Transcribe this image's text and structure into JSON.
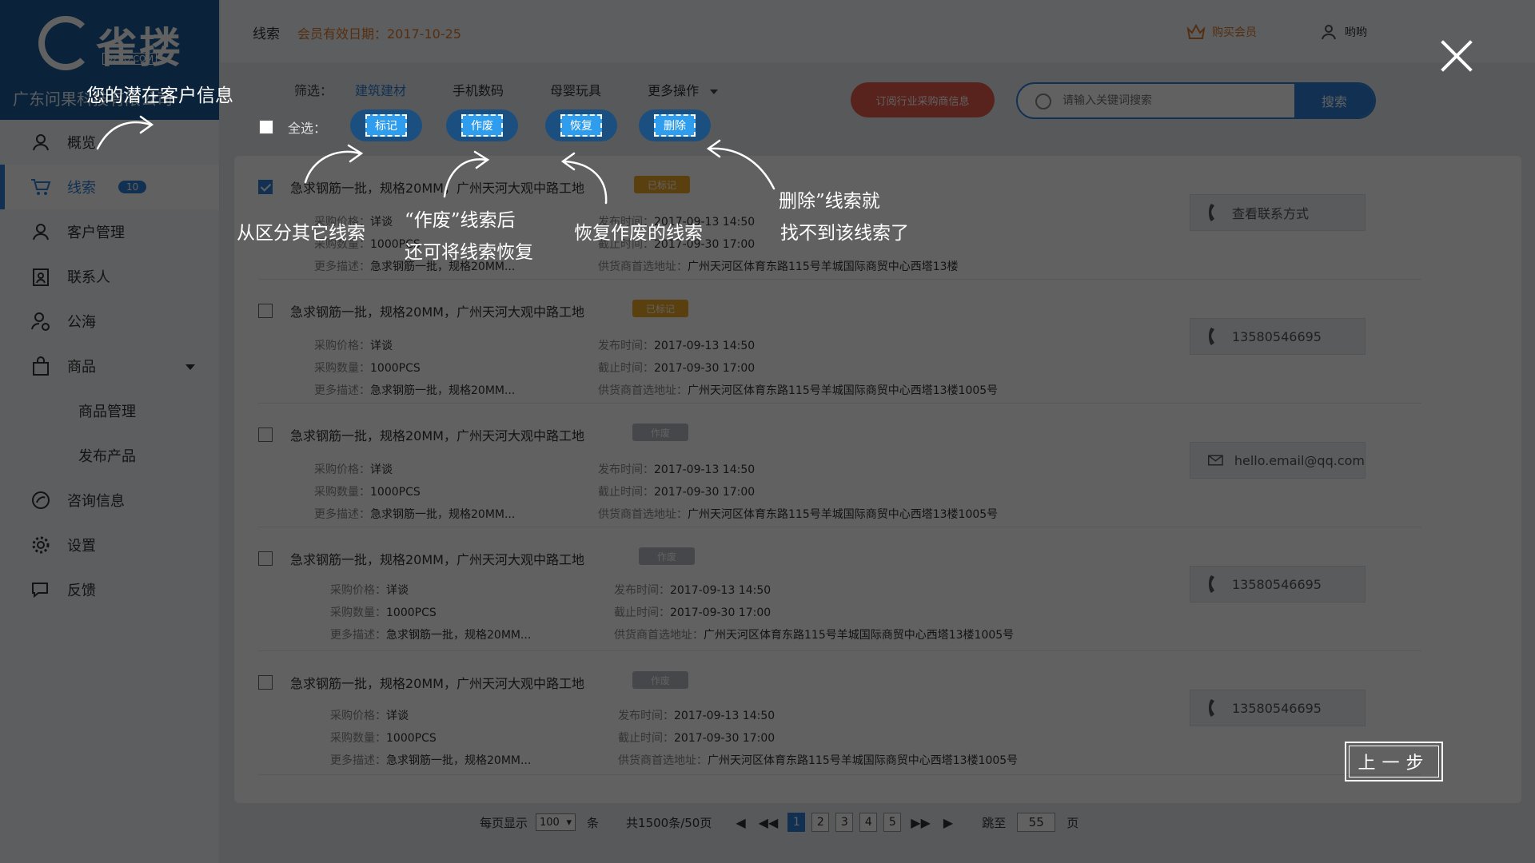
{
  "brand": {
    "logo_text": "雀搂",
    "logo_sub": "Q2SO.COM",
    "company": "广东问果科技有限公司"
  },
  "sidebar": {
    "items": [
      {
        "label": "概览"
      },
      {
        "label": "线索",
        "badge": "10"
      },
      {
        "label": "客户管理"
      },
      {
        "label": "联系人"
      },
      {
        "label": "公海"
      },
      {
        "label": "商品"
      },
      {
        "label": "商品管理"
      },
      {
        "label": "发布产品"
      },
      {
        "label": "咨询信息"
      },
      {
        "label": "设置"
      },
      {
        "label": "反馈"
      }
    ]
  },
  "header": {
    "breadcrumb": "线索",
    "membership": "会员有效日期：2017-10-25",
    "buy_label": "购买会员",
    "user_name": "哟哟"
  },
  "filter": {
    "label": "筛选：",
    "options": [
      "建筑建材",
      "手机数码",
      "母婴玩具",
      "更多操作"
    ],
    "selected": "建筑建材"
  },
  "subscribe_label": "订阅行业采购商信息",
  "search": {
    "placeholder": "请输入关键词搜索",
    "button": "搜索"
  },
  "select_all_label": "全选：",
  "actions": {
    "mark": "标记",
    "void": "作废",
    "restore": "恢复",
    "delete": "删除"
  },
  "leads": [
    {
      "title": "急求钢筋一批，规格20MM，广州天河大观中路工地",
      "tag": "已标记",
      "price_label": "采购价格：",
      "price": "详谈",
      "qty_label": "采购数量：",
      "qty": "1000PCS",
      "desc_label": "更多描述：",
      "desc": "急求钢筋一批，规格20MM...",
      "pub_label": "发布时间：",
      "pub": "2017-09-13 14:50",
      "end_label": "截止时间：",
      "end": "2017-09-30 17:00",
      "addr_label": "供货商首选地址：",
      "addr": "广州天河区体育东路115号羊城国际商贸中心西塔13楼",
      "contact": "查看联系方式",
      "checked": true
    },
    {
      "title": "急求钢筋一批，规格20MM，广州天河大观中路工地",
      "tag": "已标记",
      "price_label": "采购价格：",
      "price": "详谈",
      "qty_label": "采购数量：",
      "qty": "1000PCS",
      "desc_label": "更多描述：",
      "desc": "急求钢筋一批，规格20MM...",
      "pub_label": "发布时间：",
      "pub": "2017-09-13 14:50",
      "end_label": "截止时间：",
      "end": "2017-09-30 17:00",
      "addr_label": "供货商首选地址：",
      "addr": "广州天河区体育东路115号羊城国际商贸中心西塔13楼1005号",
      "contact": "13580546695",
      "checked": false
    },
    {
      "title": "急求钢筋一批，规格20MM，广州天河大观中路工地",
      "tag": "作废",
      "price_label": "采购价格：",
      "price": "详谈",
      "qty_label": "采购数量：",
      "qty": "1000PCS",
      "desc_label": "更多描述：",
      "desc": "急求钢筋一批，规格20MM...",
      "pub_label": "发布时间：",
      "pub": "2017-09-13 14:50",
      "end_label": "截止时间：",
      "end": "2017-09-30 17:00",
      "addr_label": "供货商首选地址：",
      "addr": "广州天河区体育东路115号羊城国际商贸中心西塔13楼1005号",
      "contact": "hello.email@qq.com",
      "checked": false
    },
    {
      "title": "急求钢筋一批，规格20MM，广州天河大观中路工地",
      "tag": "作废",
      "price_label": "采购价格：",
      "price": "详谈",
      "qty_label": "采购数量：",
      "qty": "1000PCS",
      "desc_label": "更多描述：",
      "desc": "急求钢筋一批，规格20MM...",
      "pub_label": "发布时间：",
      "pub": "2017-09-13 14:50",
      "end_label": "截止时间：",
      "end": "2017-09-30 17:00",
      "addr_label": "供货商首选地址：",
      "addr": "广州天河区体育东路115号羊城国际商贸中心西塔13楼1005号",
      "contact": "13580546695",
      "checked": false
    },
    {
      "title": "急求钢筋一批，规格20MM，广州天河大观中路工地",
      "tag": "作废",
      "price_label": "采购价格：",
      "price": "详谈",
      "qty_label": "采购数量：",
      "qty": "1000PCS",
      "desc_label": "更多描述：",
      "desc": "急求钢筋一批，规格20MM...",
      "pub_label": "发布时间：",
      "pub": "2017-09-13 14:50",
      "end_label": "截止时间：",
      "end": "2017-09-30 17:00",
      "addr_label": "供货商首选地址：",
      "addr": "广州天河区体育东路115号羊城国际商贸中心西塔13楼1005号",
      "contact": "13580546695",
      "checked": false
    }
  ],
  "pager": {
    "per_page_label": "每页显示",
    "per_page_value": "100",
    "per_page_unit": "条",
    "total": "共1500条/50页",
    "pages": [
      "1",
      "2",
      "3",
      "4",
      "5"
    ],
    "current_page": "1",
    "jump_label": "跳至",
    "jump_value": "55",
    "jump_unit": "页"
  },
  "guide": {
    "note_potential": "您的潜在客户信息",
    "note_mark": "从区分其它线索",
    "note_void_1": "“作废”线索后",
    "note_void_2": "还可将线索恢复",
    "note_restore": "恢复作废的线索",
    "note_delete_1": "删除”线索就",
    "note_delete_2": "找不到该线索了",
    "prev_button": "上一步"
  },
  "colors": {
    "brand_blue": "#2f7fd8",
    "tag_marked": "#f0a928",
    "tag_void": "#b8bcc2",
    "subscribe_red": "#e65a4d",
    "member_orange": "#e07a2b"
  }
}
